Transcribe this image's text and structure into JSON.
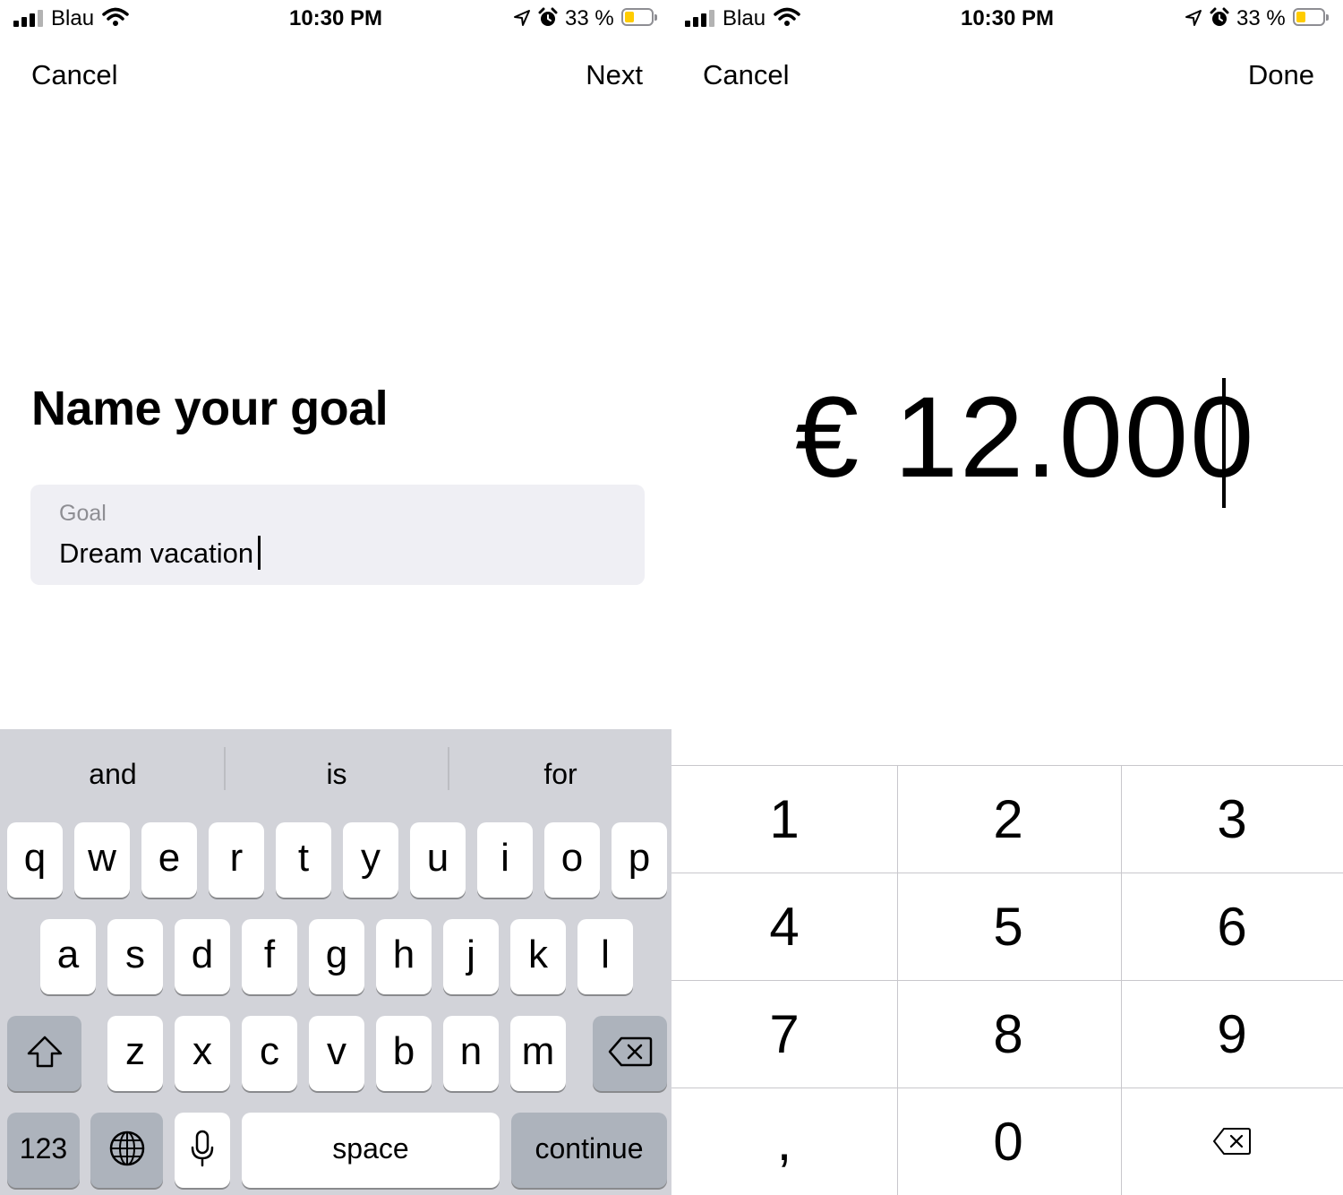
{
  "status_bar": {
    "carrier": "Blau",
    "time": "10:30 PM",
    "battery_percent": "33 %",
    "battery_level": 0.33,
    "battery_color": "#ffcc00",
    "icons": [
      "signal-icon",
      "wifi-icon",
      "location-arrow-icon",
      "alarm-icon",
      "battery-icon"
    ]
  },
  "left_screen": {
    "nav": {
      "cancel": "Cancel",
      "next": "Next"
    },
    "title": "Name your goal",
    "goal_field": {
      "label": "Goal",
      "value": "Dream vacation"
    },
    "keyboard": {
      "suggestions": [
        "and",
        "is",
        "for"
      ],
      "row1": [
        "q",
        "w",
        "e",
        "r",
        "t",
        "y",
        "u",
        "i",
        "o",
        "p"
      ],
      "row2": [
        "a",
        "s",
        "d",
        "f",
        "g",
        "h",
        "j",
        "k",
        "l"
      ],
      "row3": [
        "z",
        "x",
        "c",
        "v",
        "b",
        "n",
        "m"
      ],
      "numbers_key": "123",
      "space_key": "space",
      "return_key": "continue",
      "icons": {
        "shift": "shift-icon",
        "delete": "delete-icon",
        "globe": "globe-icon",
        "mic": "microphone-icon"
      }
    }
  },
  "right_screen": {
    "nav": {
      "cancel": "Cancel",
      "done": "Done"
    },
    "amount": "€ 12.000",
    "numpad": {
      "keys": [
        "1",
        "2",
        "3",
        "4",
        "5",
        "6",
        "7",
        "8",
        "9",
        ",",
        "0"
      ],
      "delete_icon": "delete-icon"
    }
  }
}
